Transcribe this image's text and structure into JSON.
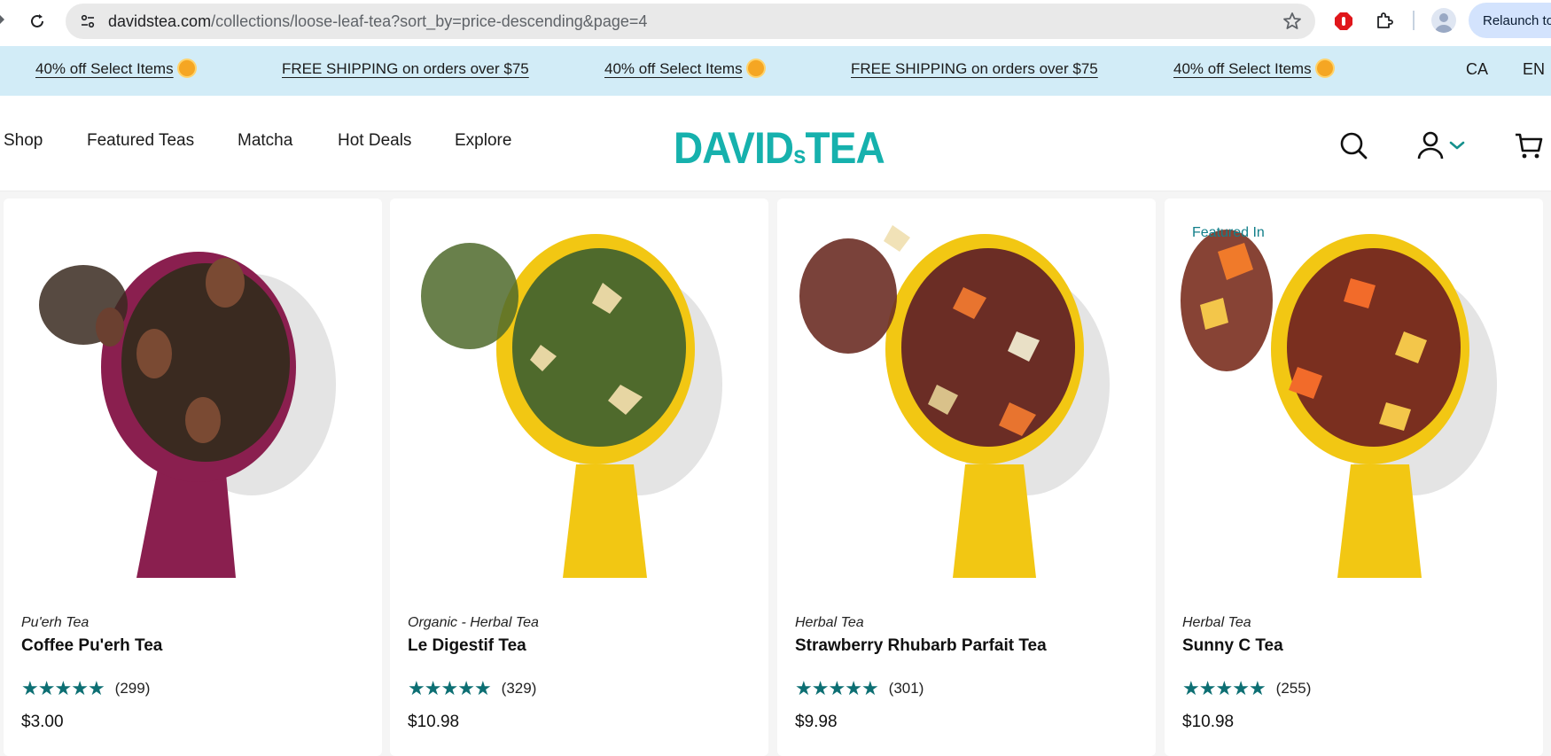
{
  "browser": {
    "url_host": "davidstea.com",
    "url_path": "/collections/loose-leaf-tea?sort_by=price-descending&page=4",
    "relaunch_label": "Relaunch to"
  },
  "promo": {
    "items": [
      "40% off Select Items",
      "FREE SHIPPING on orders over $75",
      "40% off Select Items",
      "FREE SHIPPING on orders over $75",
      "40% off Select Items"
    ],
    "country": "CA",
    "language": "EN"
  },
  "nav": {
    "items": [
      "Shop",
      "Featured Teas",
      "Matcha",
      "Hot Deals",
      "Explore"
    ]
  },
  "logo": {
    "main": "DAVID",
    "s": "s",
    "tail": "TEA",
    "color": "#16b1ad"
  },
  "header_icons": [
    "search-icon",
    "account-icon",
    "chevron-down-icon",
    "cart-icon"
  ],
  "products": [
    {
      "badge": "",
      "category": "Pu'erh Tea",
      "title": "Coffee Pu'erh Tea",
      "rating": 4.5,
      "reviews": "(299)",
      "price": "$3.00",
      "spoon_color": "#8a1f4f",
      "leaf_color": "#3a2a20"
    },
    {
      "badge": "",
      "category": "Organic - Herbal Tea",
      "title": "Le Digestif Tea",
      "rating": 4.5,
      "reviews": "(329)",
      "price": "$10.98",
      "spoon_color": "#f2c713",
      "leaf_color": "#4f6a2c"
    },
    {
      "badge": "",
      "category": "Herbal Tea",
      "title": "Strawberry Rhubarb Parfait Tea",
      "rating": 4.5,
      "reviews": "(301)",
      "price": "$9.98",
      "spoon_color": "#f2c713",
      "leaf_color": "#6b2d25"
    },
    {
      "badge": "Featured In",
      "category": "Herbal Tea",
      "title": "Sunny C Tea",
      "rating": 4.5,
      "reviews": "(255)",
      "price": "$10.98",
      "spoon_color": "#f2c713",
      "leaf_color": "#7a2f1f"
    }
  ]
}
